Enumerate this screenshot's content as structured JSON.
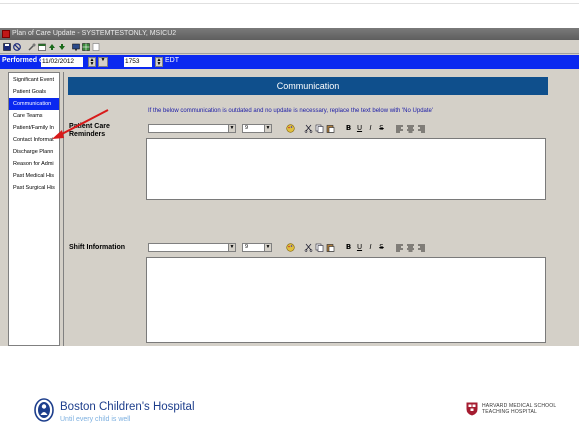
{
  "window": {
    "title": "Plan of Care Update - SYSTEMTESTONLY, MSICU2"
  },
  "toolbar": {
    "icons": [
      "save-icon",
      "cancel-icon",
      "tools-icon",
      "calendar-icon",
      "up-arrow-icon",
      "down-arrow-icon",
      "monitor-icon",
      "grid-icon",
      "page-icon"
    ]
  },
  "performed": {
    "label": "Performed on:",
    "date": "11/02/2012",
    "time": "1753",
    "timezone": "EDT"
  },
  "sidebar": {
    "items": [
      {
        "label": "Significant Event"
      },
      {
        "label": "Patient Goals"
      },
      {
        "label": "Communication"
      },
      {
        "label": "Care Teams"
      },
      {
        "label": "Patient/Family In"
      },
      {
        "label": "Contact Informat"
      },
      {
        "label": "Discharge Plann"
      },
      {
        "label": "Reason for Admi"
      },
      {
        "label": "Past Medical His"
      },
      {
        "label": "Past Surgical His"
      }
    ],
    "active_index": 2
  },
  "section": {
    "title": "Communication",
    "note": "If the below communication is outdated and no update is necessary, replace the text below with 'No Update'"
  },
  "fields": {
    "reminders": {
      "label_line1": "Patient Care",
      "label_line2": "Reminders",
      "font": "",
      "size": "9"
    },
    "shift": {
      "label": "Shift Information",
      "font": "",
      "size": "9"
    }
  },
  "format_buttons": {
    "bold": "B",
    "underline": "U",
    "italic": "I",
    "strike": "S"
  },
  "footer": {
    "brand_name": "Boston Children's Hospital",
    "brand_tagline": "Until every child is well",
    "partner_line1": "HARVARD MEDICAL SCHOOL",
    "partner_line2": "TEACHING HOSPITAL"
  },
  "colors": {
    "date_bar": "#0a28f0",
    "header_bar": "#0f4f8c",
    "note_text": "#1a1aa6",
    "brand_blue": "#1d3e8c"
  }
}
